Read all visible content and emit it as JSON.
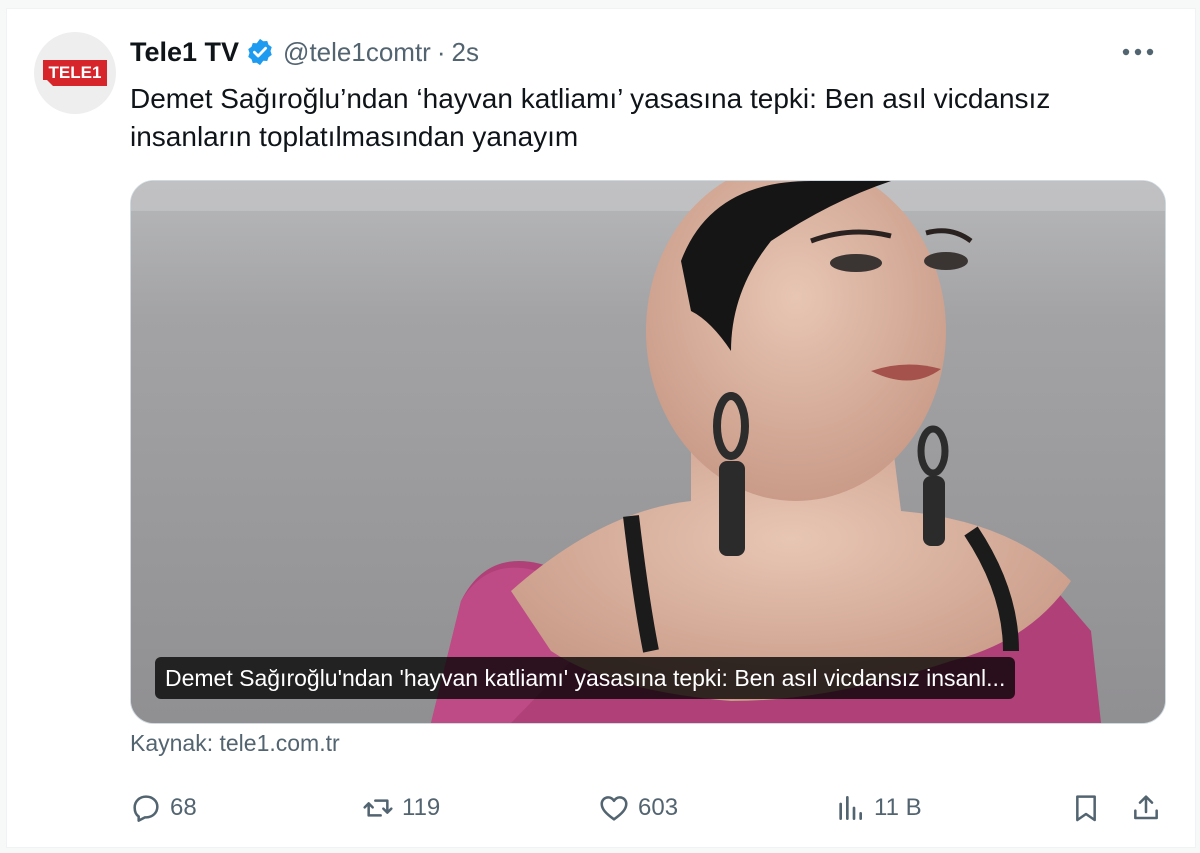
{
  "tweet": {
    "author_name": "Tele1 TV",
    "handle": "@tele1comtr",
    "separator": "·",
    "time": "2s",
    "text": "Demet Sağıroğlu’ndan ‘hayvan katliamı’ yasasına tepki: Ben asıl vicdansız insanların toplatılmasından yanayım",
    "avatar_logo_text": "TELE1",
    "media_caption": "Demet Sağıroğlu'ndan 'hayvan katliamı' yasasına tepki: Ben asıl vicdansız insanl...",
    "source": "Kaynak: tele1.com.tr"
  },
  "actions": {
    "replies": "68",
    "reposts": "119",
    "likes": "603",
    "views": "11 B"
  },
  "icons": {
    "verified": "verified-badge-icon",
    "more": "more-dots-icon",
    "reply": "reply-icon",
    "repost": "repost-icon",
    "like": "heart-icon",
    "views": "views-chart-icon",
    "bookmark": "bookmark-icon",
    "share": "share-icon"
  },
  "colors": {
    "verified_blue": "#1d9bf0",
    "brand_red": "#d6252b",
    "secondary_text": "#536471"
  }
}
